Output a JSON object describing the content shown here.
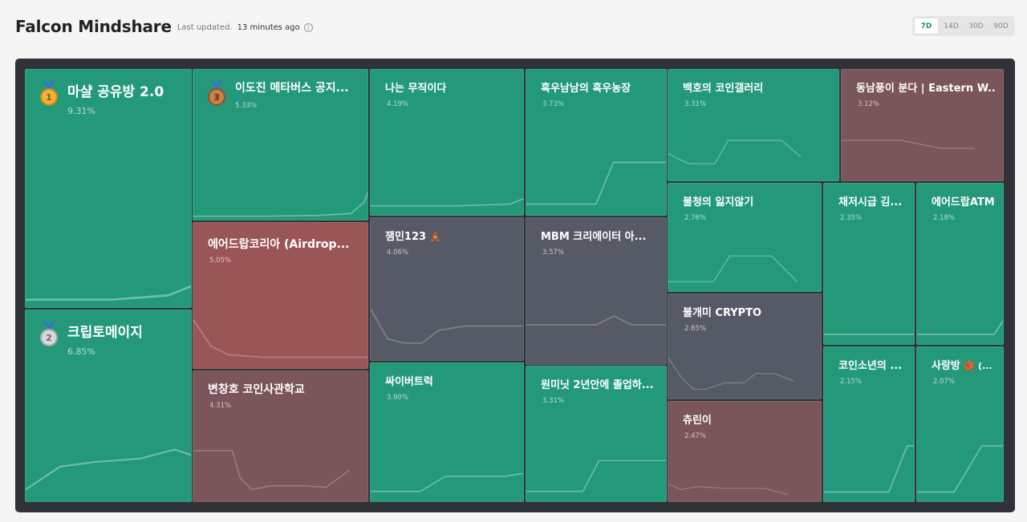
{
  "header": {
    "title": "Falcon Mindshare",
    "updated_label": "Last updated.",
    "updated_value": "13 minutes ago",
    "info_glyph": "i"
  },
  "ranges": [
    "7D",
    "14D",
    "30D",
    "90D"
  ],
  "active_range": "7D",
  "colors": {
    "up": "#23997a",
    "down_strong": "#9a5656",
    "down": "#7a5559",
    "flat": "#555a66",
    "board": "#2f3337"
  },
  "tiles": [
    {
      "name": "마샬 공유방 2.0",
      "pct": "9.31%",
      "medal": "1"
    },
    {
      "name": "크립토메이지",
      "pct": "6.85%",
      "medal": "2"
    },
    {
      "name": "이도진 메타버스 공지...",
      "pct": "5.33%",
      "medal": "3"
    },
    {
      "name": "에어드랍코리아 (Airdrop...",
      "pct": "5.05%"
    },
    {
      "name": "변창호 코인사관학교",
      "pct": "4.31%"
    },
    {
      "name": "나는 무직이다",
      "pct": "4.19%"
    },
    {
      "name": "잼민123",
      "pct": "4.06%",
      "emoji": "🧸"
    },
    {
      "name": "싸이버트럭",
      "pct": "3.90%"
    },
    {
      "name": "흑우남남의 흑우농장",
      "pct": "3.73%"
    },
    {
      "name": "MBM 크리에이터 아...",
      "pct": "3.57%"
    },
    {
      "name": "원미닛 2년안에 졸업하...",
      "pct": "3.31%"
    },
    {
      "name": "백호의 코인갤러리",
      "pct": "3.31%"
    },
    {
      "name": "동남풍이 분다 | Eastern W...",
      "pct": "3.12%"
    },
    {
      "name": "불청의 잃지않기",
      "pct": "2.76%"
    },
    {
      "name": "불개미 CRYPTO",
      "pct": "2.65%"
    },
    {
      "name": "츄린이",
      "pct": "2.47%"
    },
    {
      "name": "채저시급 김...",
      "pct": "2.35%"
    },
    {
      "name": "에어드랍ATM",
      "pct": "2.18%"
    },
    {
      "name": "코인소년의 ...",
      "pct": "2.15%"
    },
    {
      "name": "사랑방",
      "pct": "2.07%",
      "emoji": "🏀 (..."
    }
  ]
}
